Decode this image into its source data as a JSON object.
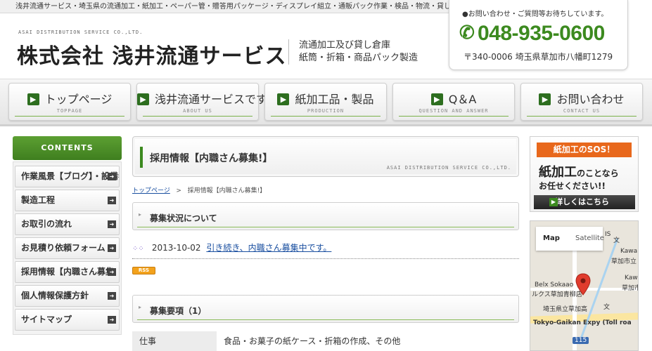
{
  "topbar": {
    "text": "浅井流通サービス・埼玉県の流通加工・紙加工・ペーパー管・贈答用パッケージ・ディスプレイ組立・通販パック作業・検品・物流・貸し倉庫"
  },
  "header": {
    "company_en": "ASAI DISTRIBUTION SERVICE CO.,LTD.",
    "company_name": "株式会社 浅井流通サービス",
    "tagline_1": "流通加工及び貸し倉庫",
    "tagline_2": "紙筒・折箱・商品パック製造",
    "contact_msg": "●お問い合わせ・ご質問等お待ちしています。",
    "phone": "048-935-0600",
    "address": "〒340-0006 埼玉県草加市八幡町1279"
  },
  "nav": [
    {
      "label": "トップページ",
      "en": "TOPPAGE"
    },
    {
      "label": "浅井流通サービスです",
      "en": "ABOUT US"
    },
    {
      "label": "紙加工品・製品",
      "en": "PRODUCTION"
    },
    {
      "label": "Q＆A",
      "en": "QUESTION AND ANSWER"
    },
    {
      "label": "お問い合わせ",
      "en": "CONTACT US"
    }
  ],
  "sidebar": {
    "heading": "CONTENTS",
    "items": [
      {
        "label": "作業風景【ブログ】・設備者"
      },
      {
        "label": "製造工程"
      },
      {
        "label": "お取引の流れ"
      },
      {
        "label": "お見積り依頼フォーム"
      },
      {
        "label": "採用情報【内職さん募集"
      },
      {
        "label": "個人情報保護方針"
      },
      {
        "label": "サイトマップ"
      }
    ]
  },
  "main": {
    "title": "採用情報【内職さん募集!】",
    "title_en": "ASAI DISTRIBUTION SERVICE CO.,LTD.",
    "breadcrumb_home": "トップページ",
    "breadcrumb_sep": ">",
    "breadcrumb_current": "採用情報【内職さん募集!】",
    "section1_title": "募集状況について",
    "news_date": "2013-10-02",
    "news_link": "引き続き、内職さん募集中です。",
    "rss_label": "RSS",
    "section2_title": "募集要項（1）",
    "job_key": "仕事",
    "job_value": "食品・お菓子の紙ケース・折箱の作成、その他"
  },
  "rightcol": {
    "sos_label": "紙加工のSOS！",
    "sos_line1_big": "紙加工",
    "sos_line1_small": "のことなら",
    "sos_line2": "お任せください!!",
    "sos_button": "詳しくはこちら",
    "map_tab_map": "Map",
    "map_tab_satellite": "Satellite",
    "map_labels": {
      "kawa1": "Kawa",
      "soka1": "草加市立",
      "kaw2": "Kaw",
      "soka2": "草加市立",
      "belx": "Belx Sokaao",
      "belx_jp": "ルクス草加青柳店",
      "school": "埼玉県立草加高",
      "expy": "Tokyo-Gaikan Expy (Toll roa",
      "route": "115",
      "s1": "IS",
      "bun1": "文",
      "bun2": "文"
    }
  }
}
